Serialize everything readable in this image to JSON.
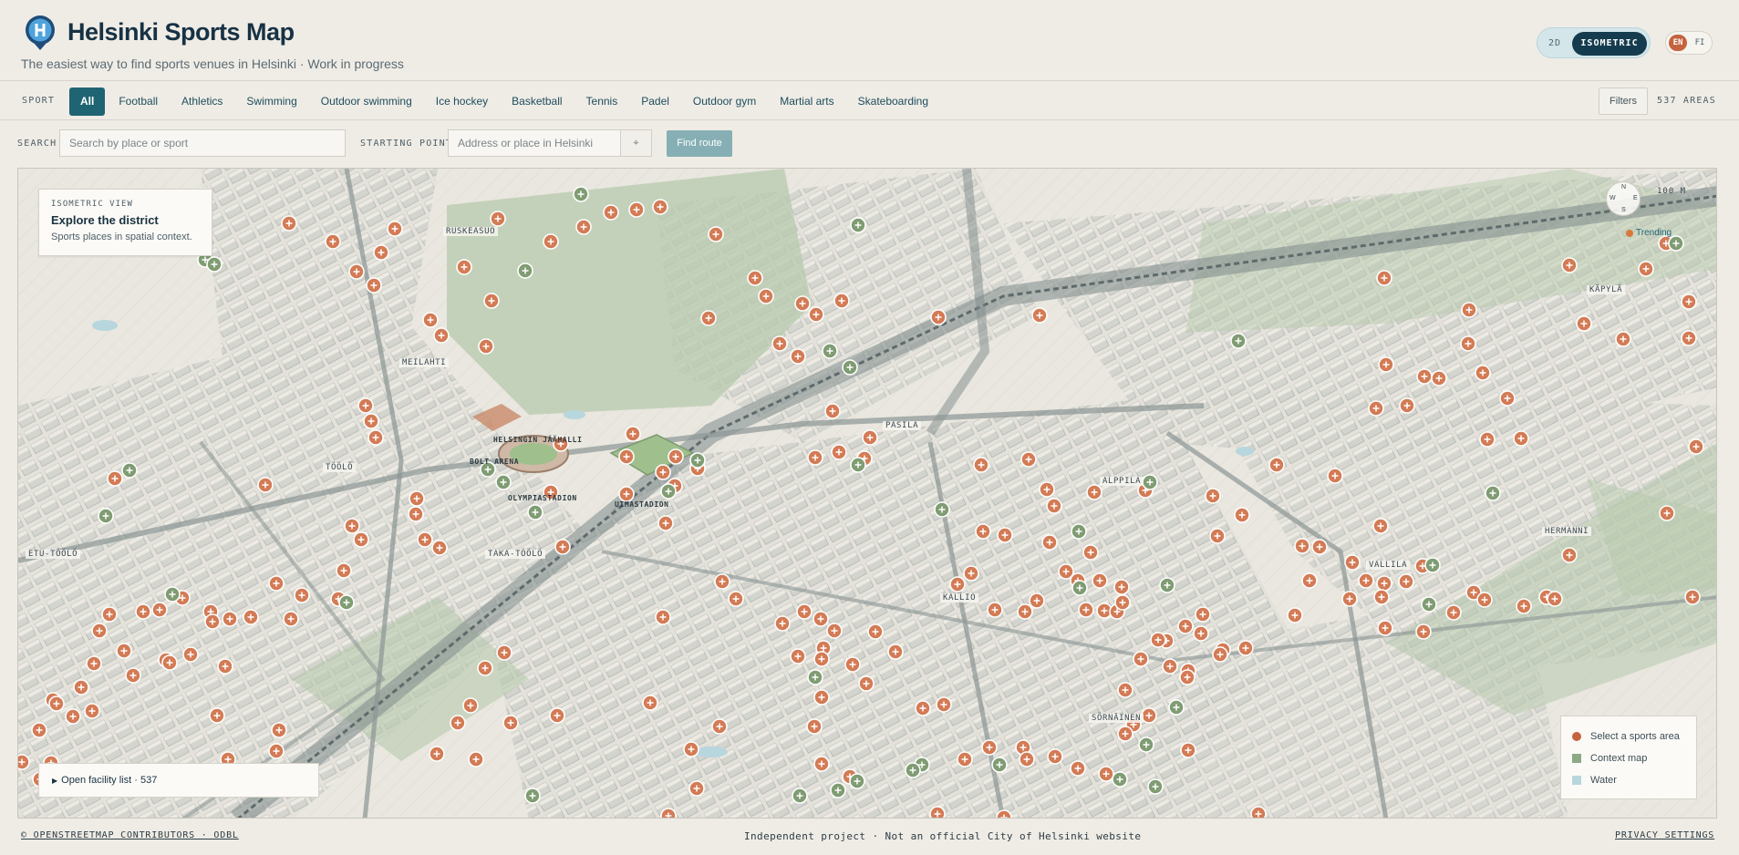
{
  "header": {
    "title": "Helsinki Sports Map",
    "subtitle": "The easiest way to find sports venues in Helsinki · Work in progress",
    "view_modes": [
      "2D",
      "ISOMETRIC"
    ],
    "active_view": "ISOMETRIC",
    "languages": [
      "EN",
      "FI"
    ],
    "active_language": "EN"
  },
  "sport_filter": {
    "label": "SPORT",
    "chips": [
      "All",
      "Football",
      "Athletics",
      "Swimming",
      "Outdoor swimming",
      "Ice hockey",
      "Basketball",
      "Tennis",
      "Padel",
      "Outdoor gym",
      "Martial arts",
      "Skateboarding"
    ],
    "active": "All",
    "filters_label": "Filters",
    "areas_count": "537 AREAS"
  },
  "search": {
    "label": "SEARCH",
    "placeholder": "Search by place or sport",
    "start_label": "STARTING POINT",
    "start_placeholder": "Address or place in Helsinki",
    "locate_symbol": "⌖",
    "route_button": "Find route"
  },
  "map": {
    "info_card": {
      "kicker": "ISOMETRIC VIEW",
      "title": "Explore the district",
      "text": "Sports places in spatial context."
    },
    "scale": "100 M",
    "compass": {
      "n": "N",
      "e": "E",
      "s": "S",
      "w": "W"
    },
    "trending_label": "Trending",
    "districts": [
      "RUSKEASUO",
      "MEILAHTI",
      "TÖÖLÖ",
      "ETU-TÖÖLÖ",
      "TAKA-TÖÖLÖ",
      "PASILA",
      "ALPPILA",
      "VALLILA",
      "KALLIO",
      "HERMANNI",
      "KÄPYLÄ",
      "SÖRNÄINEN"
    ],
    "landmarks": [
      "HELSINGIN JÄÄHALLI",
      "BOLT ARENA",
      "OLYMPIASTADION",
      "UIMASTADION"
    ],
    "facility_list": "Open facility list · 537",
    "legend": [
      {
        "label": "Select a sports area",
        "color": "#c4633f"
      },
      {
        "label": "Context map",
        "color": "#8daa86"
      },
      {
        "label": "Water",
        "color": "#b8d6de"
      }
    ],
    "colors": {
      "sports_marker": "#d37b55",
      "context_marker": "#7f9c72",
      "park": "#b7c9ad",
      "road": "#7e8a8a"
    },
    "icons": [
      "plus-icon",
      "person-icon",
      "no-entry-icon",
      "water-icon",
      "leisure-icon"
    ]
  },
  "footer": {
    "attribution": "© OPENSTREETMAP CONTRIBUTORS · ODBL",
    "disclaimer": "Independent project · Not an official City of Helsinki website",
    "privacy": "PRIVACY SETTINGS"
  }
}
